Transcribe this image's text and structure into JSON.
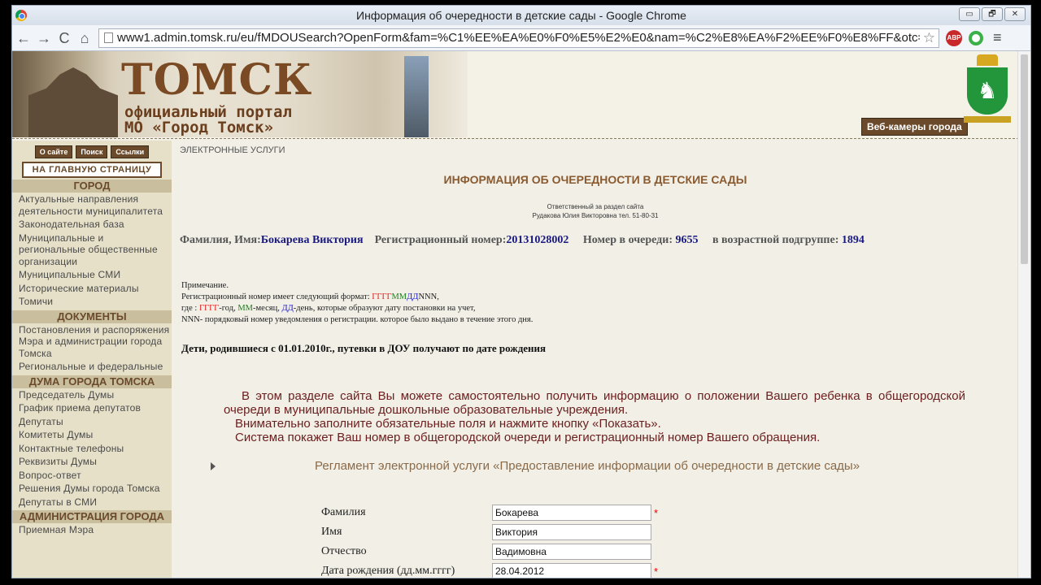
{
  "window": {
    "title": "Информация об очередности в детские сады - Google Chrome",
    "btn_min": "▭",
    "btn_max": "🗗",
    "btn_close": "✕"
  },
  "browser": {
    "url": "www1.admin.tomsk.ru/eu/fMDOUSearch?OpenForm&fam=%C1%EE%EA%E0%F0%E5%E2%E0&nam=%C2%E8%EA%F2%EE%F0%E8%FF&otc=%C2%E0%E",
    "back": "←",
    "forward": "→",
    "reload": "C",
    "home": "⌂",
    "star": "☆",
    "abp_label": "ABP",
    "menu": "≡"
  },
  "banner": {
    "title": "ТОМСК",
    "subtitle_1": "официальный портал",
    "subtitle_2": "МО «Город Томск»",
    "webcam": "Веб-камеры города",
    "emblem_glyph": "♞"
  },
  "sidebar": {
    "top_buttons": [
      "О сайте",
      "Поиск",
      "Ссылки"
    ],
    "home": "НА ГЛАВНУЮ СТРАНИЦУ",
    "sections": [
      {
        "title": "ГОРОД",
        "items": [
          "Актуальные направления деятельности муниципалитета",
          "Законодательная база",
          "Муниципальные и региональные общественные организации",
          "Муниципальные СМИ",
          "Исторические материалы",
          "Томичи"
        ]
      },
      {
        "title": "ДОКУМЕНТЫ",
        "items": [
          "Постановления и распоряжения Мэра и администрации города Томска",
          "Региональные и федеральные"
        ]
      },
      {
        "title": "ДУМА ГОРОДА ТОМСКА",
        "items": [
          "Председатель Думы",
          "График приема депутатов",
          "Депутаты",
          "Комитеты Думы",
          "Контактные телефоны",
          "Реквизиты Думы",
          "Вопрос-ответ",
          "Решения Думы города Томска",
          "Депутаты в СМИ"
        ]
      },
      {
        "title": "АДМИНИСТРАЦИЯ ГОРОДА",
        "items": [
          "Приемная Мэра"
        ]
      }
    ]
  },
  "main": {
    "breadcrumb": "ЭЛЕКТРОННЫЕ УСЛУГИ",
    "title": "ИНФОРМАЦИЯ ОБ ОЧЕРЕДНОСТИ В ДЕТСКИЕ САДЫ",
    "responsible_1": "Ответственный за раздел сайта",
    "responsible_2": "Рудакова Юлия Викторовна тел. 51-80-31",
    "info": {
      "name_label": "Фамилия, Имя:",
      "name_value": "Бокарева Виктория",
      "reg_label": "Регистрационный номер:",
      "reg_value": "20131028002",
      "queue_label": "Номер в очереди:",
      "queue_value": "9655",
      "subgroup_label": "в возрастной подгруппе:",
      "subgroup_value": "1894"
    },
    "note": {
      "title": "Примечание.",
      "l2_prefix": "Регистрационный номер имеет следующий формат: ",
      "yyyy": "ГГГГ",
      "mm": "ММ",
      "dd": "ДД",
      "nnn": "NNN,",
      "l3_prefix": "где : ",
      "l3_yyyy_desc": "-год, ",
      "l3_mm_desc": "-месяц, ",
      "l3_dd_desc": "-день, которые образуют дату постановки на учет,",
      "l4": "NNN- порядковый номер уведомления о регистрации. которое было выдано в течение этого дня."
    },
    "rule": "Дети, родившиеся с 01.01.2010г., путевки в ДОУ получают по дате рождения",
    "intro_1": "В этом разделе сайта Вы можете самостоятельно получить информацию о положении Вашего ребенка в общегородской очереди в муниципальные дошкольные образовательные учреждения.",
    "intro_2": "Внимательно заполните обязательные поля и нажмите кнопку «Показать».",
    "intro_3": "Система покажет Ваш номер в общегородской очереди и регистрационный номер Вашего обращения.",
    "reglament": "Регламент электронной услуги «Предоставление информации об очередности в детские сады»"
  },
  "form": {
    "surname_label": "Фамилия",
    "surname_value": "Бокарева",
    "name_label": "Имя",
    "name_value": "Виктория",
    "patronymic_label": "Отчество",
    "patronymic_value": "Вадимовна",
    "birth_label": "Дата рождения (дд.мм.гггг)",
    "birth_value": "28.04.2012",
    "required_mark": "*"
  }
}
